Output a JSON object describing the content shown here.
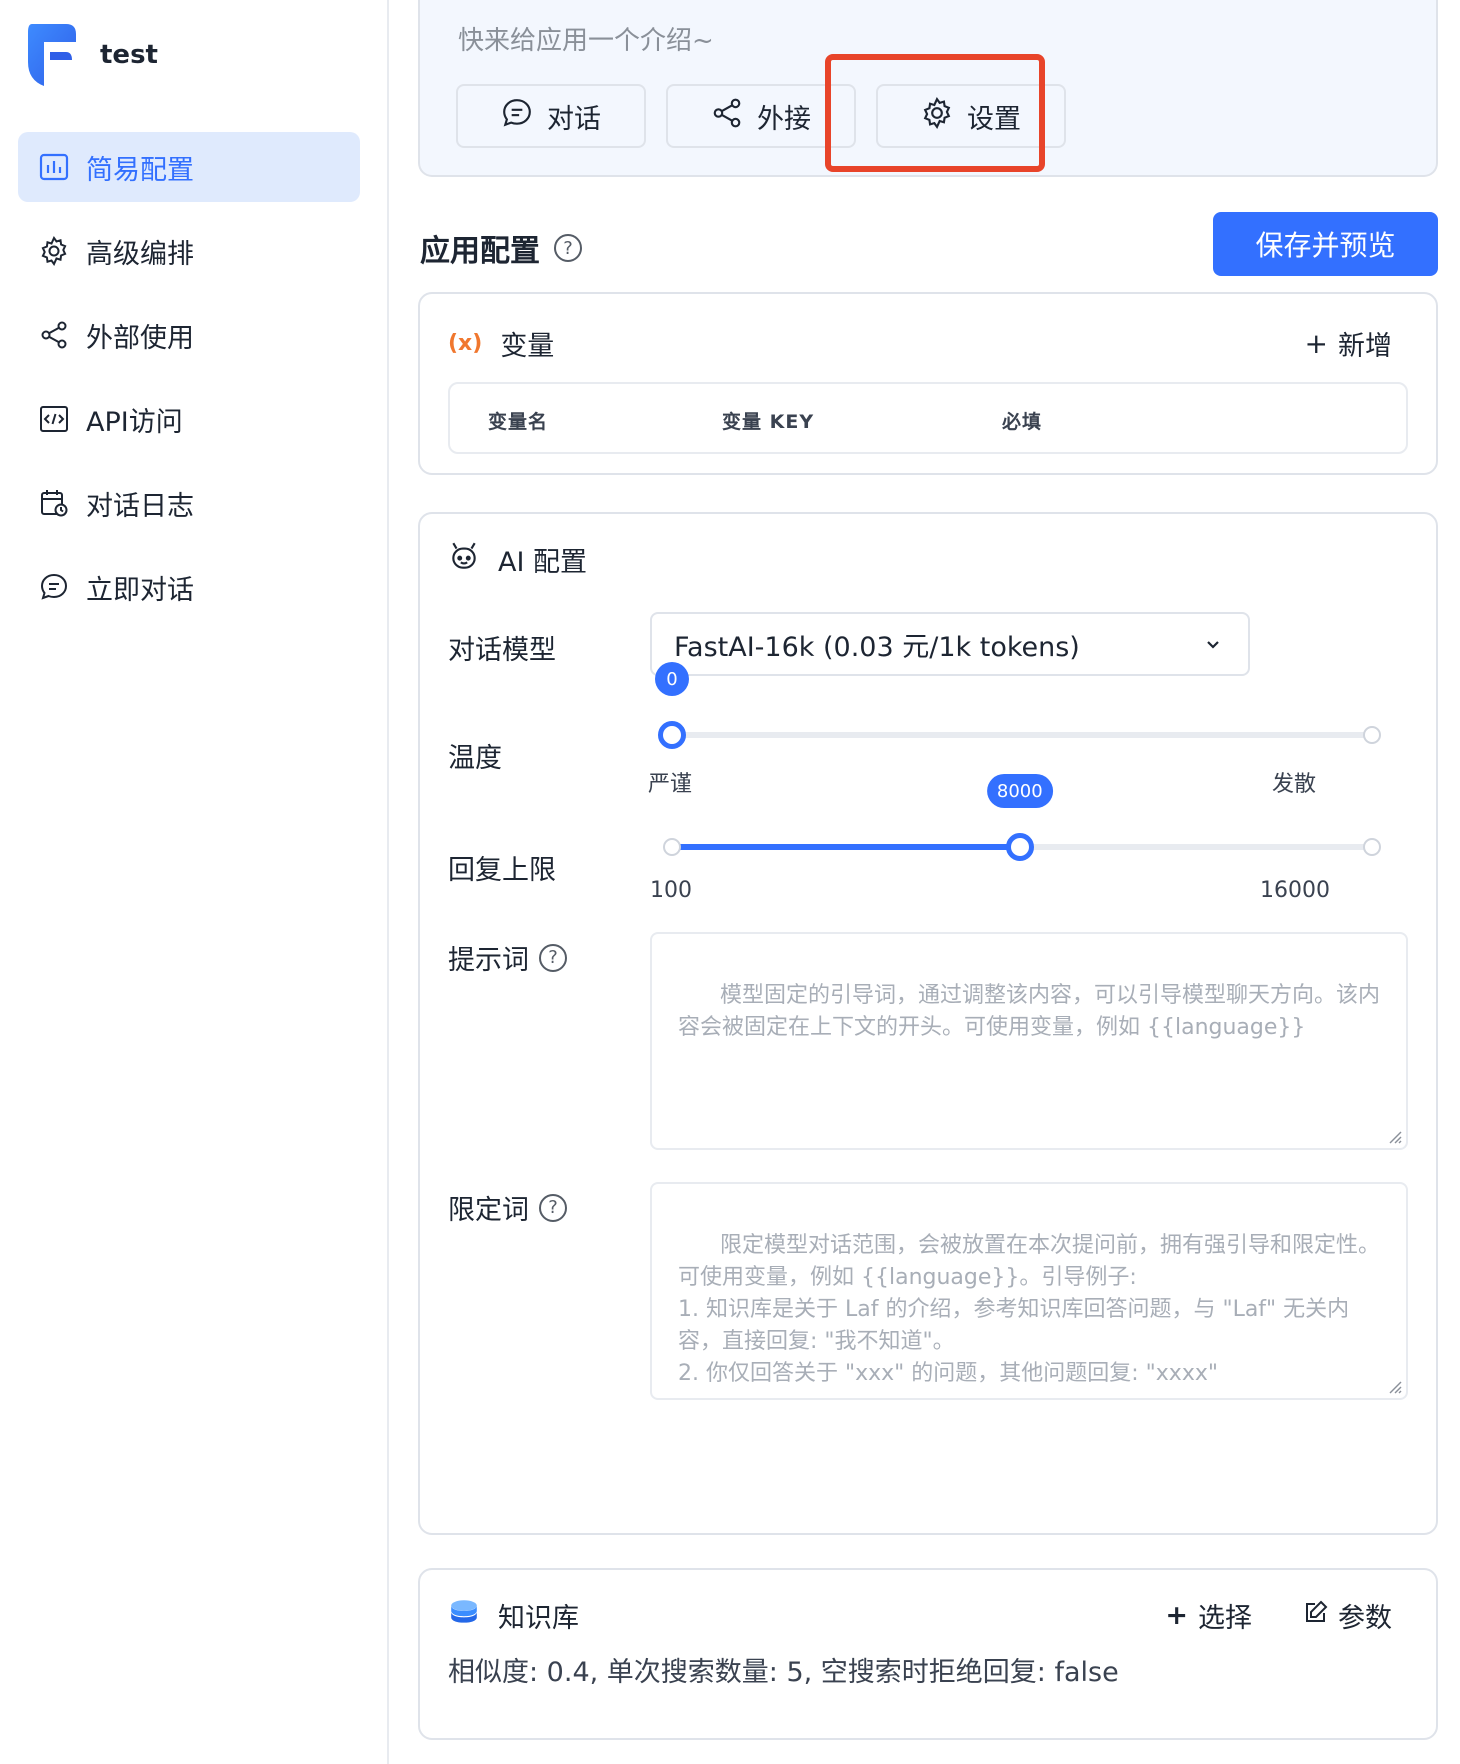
{
  "app": {
    "name": "test"
  },
  "sidebar": {
    "items": [
      {
        "label": "简易配置",
        "icon": "chart-box-icon",
        "active": true
      },
      {
        "label": "高级编排",
        "icon": "gear-icon",
        "active": false
      },
      {
        "label": "外部使用",
        "icon": "share-icon",
        "active": false
      },
      {
        "label": "API访问",
        "icon": "code-icon",
        "active": false
      },
      {
        "label": "对话日志",
        "icon": "calendar-log-icon",
        "active": false
      },
      {
        "label": "立即对话",
        "icon": "chat-bubble-icon",
        "active": false
      }
    ]
  },
  "intro": {
    "placeholder": "快来给应用一个介绍~",
    "buttons": [
      {
        "label": "对话",
        "icon": "chat-bubble-icon"
      },
      {
        "label": "外接",
        "icon": "share-icon"
      },
      {
        "label": "设置",
        "icon": "gear-icon"
      }
    ]
  },
  "config": {
    "title": "应用配置",
    "save_label": "保存并预览"
  },
  "variables": {
    "title": "变量",
    "icon_text": "(x)",
    "add_label": "新增",
    "columns": [
      "变量名",
      "变量 KEY",
      "必填"
    ]
  },
  "ai": {
    "title": "AI 配置",
    "model_label": "对话模型",
    "model_value": "FastAI-16k (0.03 元/1k tokens)",
    "temperature": {
      "label": "温度",
      "value": "0",
      "fraction": 0.0,
      "min_label": "严谨",
      "max_label": "发散"
    },
    "max_tokens": {
      "label": "回复上限",
      "value": "8000",
      "min": 100,
      "max": 16000,
      "min_label": "100",
      "max_label": "16000"
    },
    "prompt": {
      "label": "提示词",
      "placeholder": "模型固定的引导词，通过调整该内容，可以引导模型聊天方向。该内容会被固定在上下文的开头。可使用变量，例如 {{language}}"
    },
    "limit": {
      "label": "限定词",
      "placeholder": "限定模型对话范围，会被放置在本次提问前，拥有强引导和限定性。可使用变量，例如 {{language}}。引导例子:\n1. 知识库是关于 Laf 的介绍，参考知识库回答问题，与 \"Laf\" 无关内容，直接回复: \"我不知道\"。\n2. 你仅回答关于 \"xxx\" 的问题，其他问题回复: \"xxxx\""
    }
  },
  "knowledge": {
    "title": "知识库",
    "select_label": "选择",
    "params_label": "参数",
    "info": "相似度: 0.4, 单次搜索数量: 5, 空搜索时拒绝回复: false"
  },
  "colors": {
    "accent": "#3370ff",
    "active_bg": "#dfeafd",
    "highlight": "#e8442a",
    "variable_icon": "#f0772e"
  }
}
